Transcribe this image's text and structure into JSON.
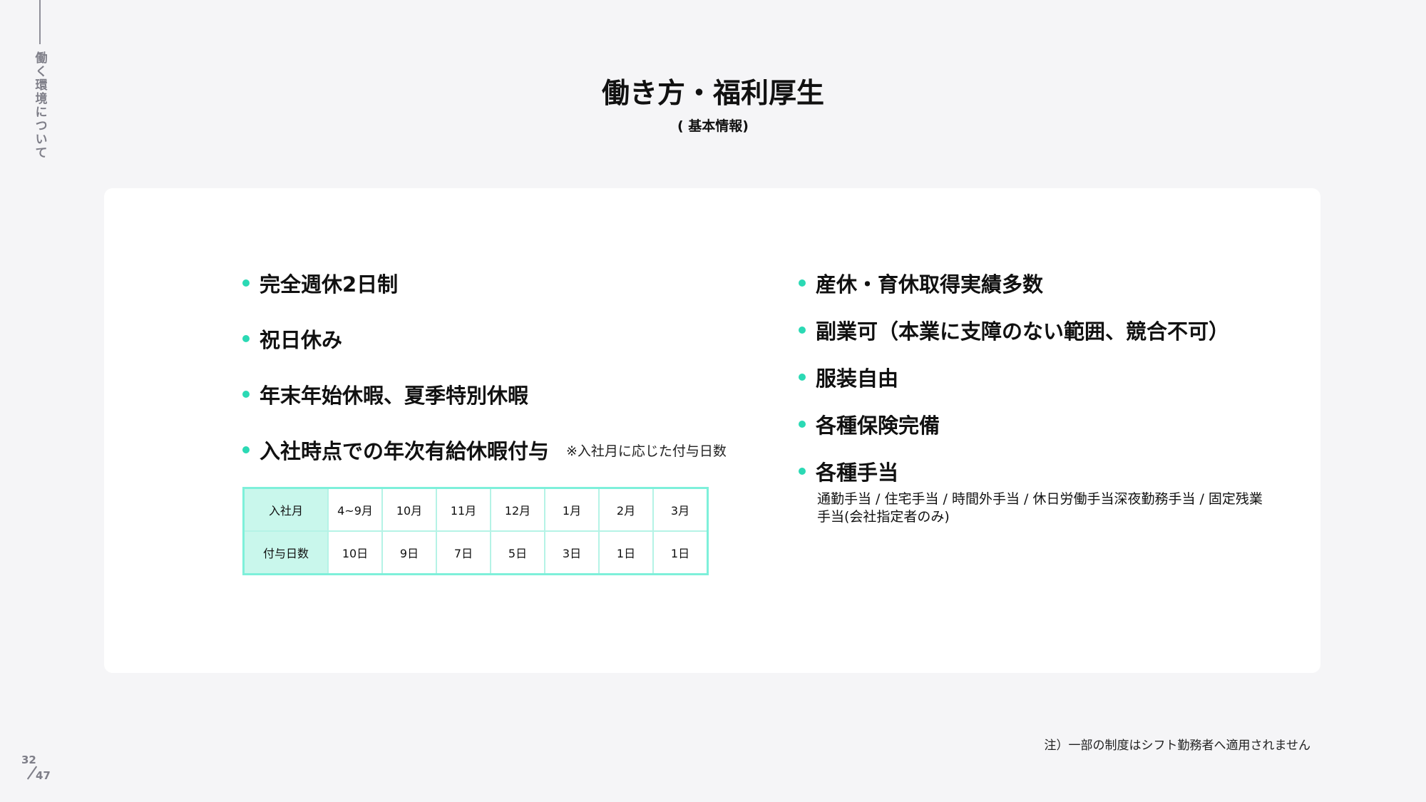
{
  "side_label": "働く環境について",
  "header": {
    "title": "働き方・福利厚生",
    "subtitle": "( 基本情報)"
  },
  "left_items": [
    {
      "label": "完全週休2日制"
    },
    {
      "label": "祝日休み"
    },
    {
      "label": "年末年始休暇、夏季特別休暇"
    },
    {
      "label": "入社時点での年次有給休暇付与",
      "note": "※入社月に応じた付与日数"
    }
  ],
  "grant_table": {
    "row_header_month": "入社月",
    "row_header_days": "付与日数",
    "months": [
      "4~9月",
      "10月",
      "11月",
      "12月",
      "1月",
      "2月",
      "3月"
    ],
    "days": [
      "10日",
      "9日",
      "7日",
      "5日",
      "3日",
      "1日",
      "1日"
    ]
  },
  "right_items": [
    {
      "label": "産休・育休取得実績多数"
    },
    {
      "label": "副業可（本業に支障のない範囲、競合不可）"
    },
    {
      "label": "服装自由"
    },
    {
      "label": "各種保険完備"
    },
    {
      "label": "各種手当"
    }
  ],
  "allowance_detail": "通勤手当 / 住宅手当 / 時間外手当 / 休日労働手当深夜勤務手当 / 固定残業手当(会社指定者のみ)",
  "footnote": "注）一部の制度はシフト勤務者へ適用されません",
  "pagination": {
    "current": "32",
    "total": "47"
  },
  "colors": {
    "accent": "#2bd9b4",
    "table_border": "#7ef0da",
    "table_header_bg": "#c9f7ec",
    "background": "#f5f5f7"
  }
}
